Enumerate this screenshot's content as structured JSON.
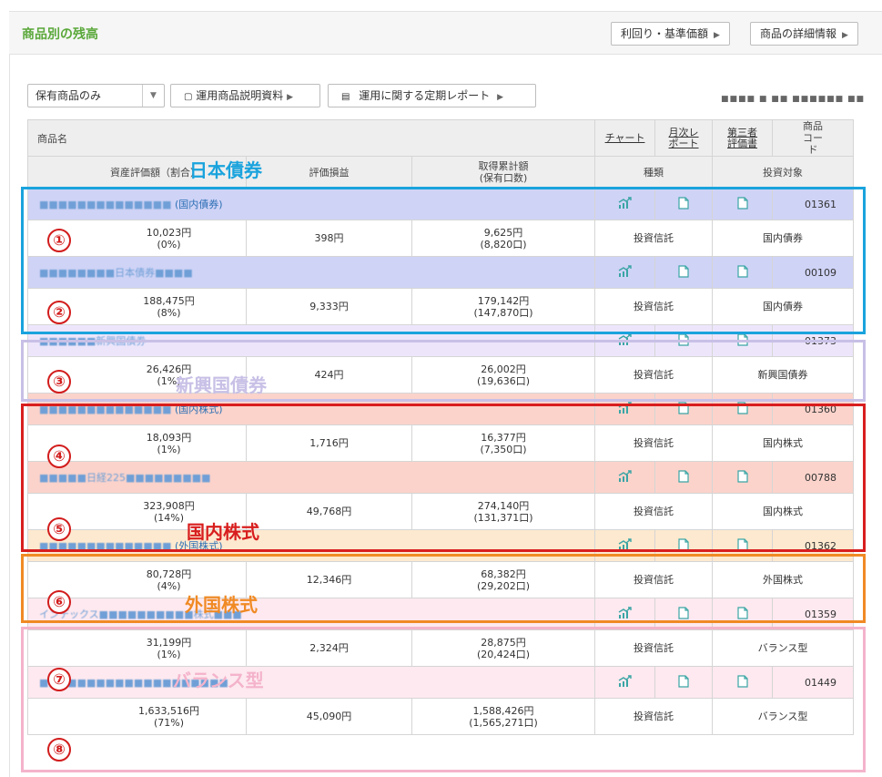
{
  "header": {
    "title": "商品別の残高",
    "btn_yield": "利回り・基準価額",
    "btn_detail": "商品の詳細情報"
  },
  "toolbar": {
    "filter_value": "保有商品のみ",
    "btn_doc": "運用商品説明資料",
    "btn_report": "運用に関する定期レポート",
    "date_text": "■■■■ ■ ■■ ■■■■■■ ■■"
  },
  "table": {
    "h_name": "商品名",
    "h_chart": "チャート",
    "h_monthly": "月次レポート",
    "h_third": "第三者評価書",
    "h_code": "商品コード",
    "h_asset": "資産評価額（割合）",
    "h_pl": "評価損益",
    "h_cost": "取得累計額",
    "h_cost_sub": "(保有口数)",
    "h_type": "種類",
    "h_target": "投資対象",
    "rows": [
      {
        "name": "■■■■■■■■■■■■■■",
        "name_sub": "(国内債券)",
        "code": "01361",
        "amount": "10,023円",
        "ratio": "(0%)",
        "pl": "398円",
        "cost": "9,625円",
        "units": "(8,820口)",
        "type": "投資信託",
        "target": "国内債券"
      },
      {
        "name": "■■■■■■■■日本債券■■■■",
        "name_sub": "",
        "code": "00109",
        "amount": "188,475円",
        "ratio": "(8%)",
        "pl": "9,333円",
        "cost": "179,142円",
        "units": "(147,870口)",
        "type": "投資信託",
        "target": "国内債券"
      },
      {
        "name": "■■■■■■新興国債券",
        "name_sub": "",
        "code": "01373",
        "amount": "26,426円",
        "ratio": "(1%)",
        "pl": "424円",
        "cost": "26,002円",
        "units": "(19,636口)",
        "type": "投資信託",
        "target": "新興国債券"
      },
      {
        "name": "■■■■■■■■■■■■■■",
        "name_sub": "(国内株式)",
        "code": "01360",
        "amount": "18,093円",
        "ratio": "(1%)",
        "pl": "1,716円",
        "cost": "16,377円",
        "units": "(7,350口)",
        "type": "投資信託",
        "target": "国内株式"
      },
      {
        "name": "■■■■■日経225■■■■■■■■■",
        "name_sub": "",
        "code": "00788",
        "amount": "323,908円",
        "ratio": "(14%)",
        "pl": "49,768円",
        "cost": "274,140円",
        "units": "(131,371口)",
        "type": "投資信託",
        "target": "国内株式"
      },
      {
        "name": "■■■■■■■■■■■■■■",
        "name_sub": "(外国株式)",
        "code": "01362",
        "amount": "80,728円",
        "ratio": "(4%)",
        "pl": "12,346円",
        "cost": "68,382円",
        "units": "(29,202口)",
        "type": "投資信託",
        "target": "外国株式"
      },
      {
        "name": "インデックス■■■■■■■■■■株式■■■",
        "name_sub": "",
        "code": "01359",
        "amount": "31,199円",
        "ratio": "(1%)",
        "pl": "2,324円",
        "cost": "28,875円",
        "units": "(20,424口)",
        "type": "投資信託",
        "target": "バランス型"
      },
      {
        "name": "■■■■■■■■■■■■■■■■■■■■",
        "name_sub": "",
        "code": "01449",
        "amount": "1,633,516円",
        "ratio": "(71%)",
        "pl": "45,090円",
        "cost": "1,588,426円",
        "units": "(1,565,271口)",
        "type": "投資信託",
        "target": "バランス型"
      }
    ]
  },
  "annotations": {
    "nums": [
      "①",
      "②",
      "③",
      "④",
      "⑤",
      "⑥",
      "⑦",
      "⑧"
    ],
    "cat_jp": "日本債券",
    "cat_em": "新興国債券",
    "cat_dom": "国内株式",
    "cat_for": "外国株式",
    "cat_bal": "バランス型"
  },
  "colors": {
    "jp_box": "#1aa3dd",
    "em_box": "#c8c0e6",
    "dom_box": "#d81e1e",
    "for_box": "#f08a24",
    "bal_box": "#f4b3cb",
    "title_green": "#5aa83a"
  }
}
